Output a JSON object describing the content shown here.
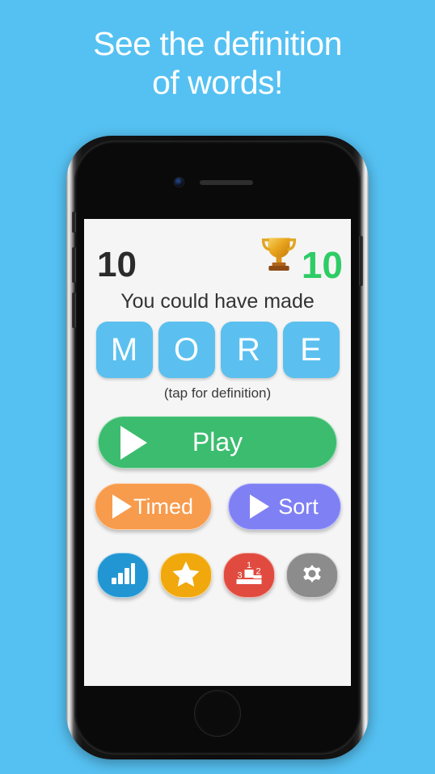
{
  "promo": {
    "headline_line1": "See the definition",
    "headline_line2": "of words!"
  },
  "colors": {
    "background": "#55C1F2",
    "screen_bg": "#F5F5F5",
    "tile_blue": "#5BC0EF",
    "best_score_green": "#2ECC66",
    "play_green": "#3CBC6E",
    "timed_orange": "#F79B4C",
    "sort_purple": "#8080F5",
    "stats_blue": "#2196D3",
    "star_amber": "#F0A80C",
    "ranks_red": "#E14B3F",
    "gear_gray": "#8C8C8C"
  },
  "app": {
    "score": "10",
    "trophy_icon": "trophy-icon",
    "best_score": "10",
    "result_message": "You could have made",
    "word_tiles": [
      "M",
      "O",
      "R",
      "E"
    ],
    "definition_hint": "(tap for definition)",
    "buttons": {
      "play": "Play",
      "timed": "Timed",
      "sort": "Sort"
    },
    "icon_buttons": [
      {
        "name": "statistics",
        "icon": "bar-chart-icon"
      },
      {
        "name": "favorites",
        "icon": "star-icon"
      },
      {
        "name": "leaderboard",
        "icon": "podium-icon",
        "ranks": [
          "1",
          "2",
          "3"
        ]
      },
      {
        "name": "settings",
        "icon": "gear-icon"
      }
    ]
  },
  "device": {
    "camera_icon": "front-camera-icon",
    "speaker_icon": "earpiece-speaker-icon",
    "home_button": "home-button"
  }
}
